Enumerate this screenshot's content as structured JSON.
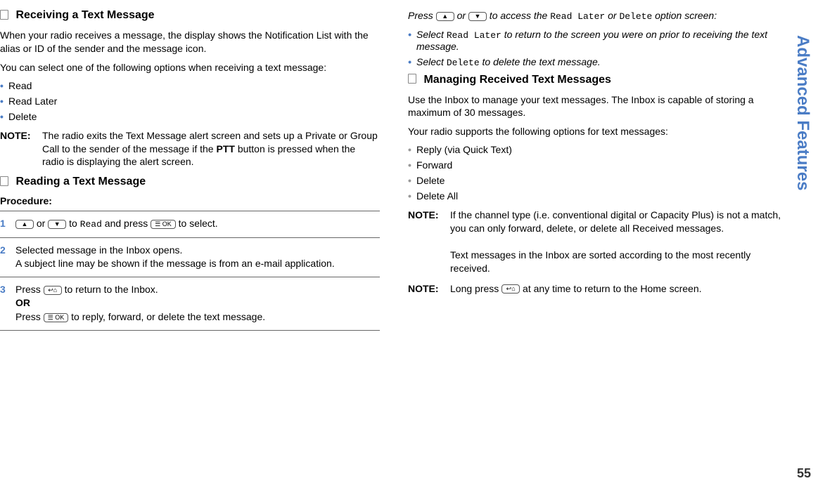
{
  "sidebar": "Advanced Features",
  "pageNumber": "55",
  "left": {
    "section1": {
      "title": "Receiving a Text Message",
      "para1": "When your radio receives a message, the display shows the Notification List with the alias or ID of the sender and the message icon.",
      "para2": "You can select one of the following options when receiving a text message:",
      "options": [
        "Read",
        "Read Later",
        "Delete"
      ],
      "noteLabel": "NOTE:",
      "noteText": "The radio exits the Text Message alert screen and sets up a Private or Group Call to the sender of the message if the ",
      "noteBold": "PTT",
      "noteText2": " button is pressed when the radio is displaying the alert screen."
    },
    "section2": {
      "title": "Reading a Text Message",
      "procedureLabel": "Procedure:",
      "step1_a": " or ",
      "step1_b": " to ",
      "step1_read": "Read",
      "step1_c": " and press ",
      "step1_d": " to select.",
      "step2_a": "Selected message in the Inbox opens.",
      "step2_b": "A subject line may be shown if the message is from an e-mail application.",
      "step3_a": "Press ",
      "step3_b": " to return to the Inbox.",
      "step3_or": "OR",
      "step3_c": "Press ",
      "step3_d": " to reply, forward, or delete the text message."
    }
  },
  "right": {
    "intro_a": "Press ",
    "intro_b": " or ",
    "intro_c": " to access the ",
    "intro_rl": "Read Later",
    "intro_d": " or ",
    "intro_del": "Delete",
    "intro_e": " option screen:",
    "bullet1_a": "Select ",
    "bullet1_rl": "Read Later",
    "bullet1_b": " to return to the screen you were on prior to receiving the text message.",
    "bullet2_a": "Select ",
    "bullet2_del": "Delete",
    "bullet2_b": " to delete the text message.",
    "section3": {
      "title": "Managing Received Text Messages",
      "para1": "Use the Inbox to manage your text messages. The Inbox is capable of storing a maximum of 30 messages.",
      "para2": "Your radio supports the following options for text messages:",
      "options": [
        "Reply (via Quick Text)",
        "Forward",
        "Delete",
        "Delete All"
      ],
      "note1Label": "NOTE:",
      "note1Text": "If the channel type (i.e. conventional digital or Capacity Plus) is not a match, you can only forward, delete, or delete all Received messages.",
      "note1Text2": "Text messages in the Inbox are sorted according to the most recently received.",
      "note2Label": "NOTE:",
      "note2TextA": "Long press ",
      "note2TextB": " at any time to return to the Home screen."
    }
  },
  "icons": {
    "up": "▲",
    "down": "▼",
    "ok": "☰ OK",
    "back": "↩⌂"
  }
}
